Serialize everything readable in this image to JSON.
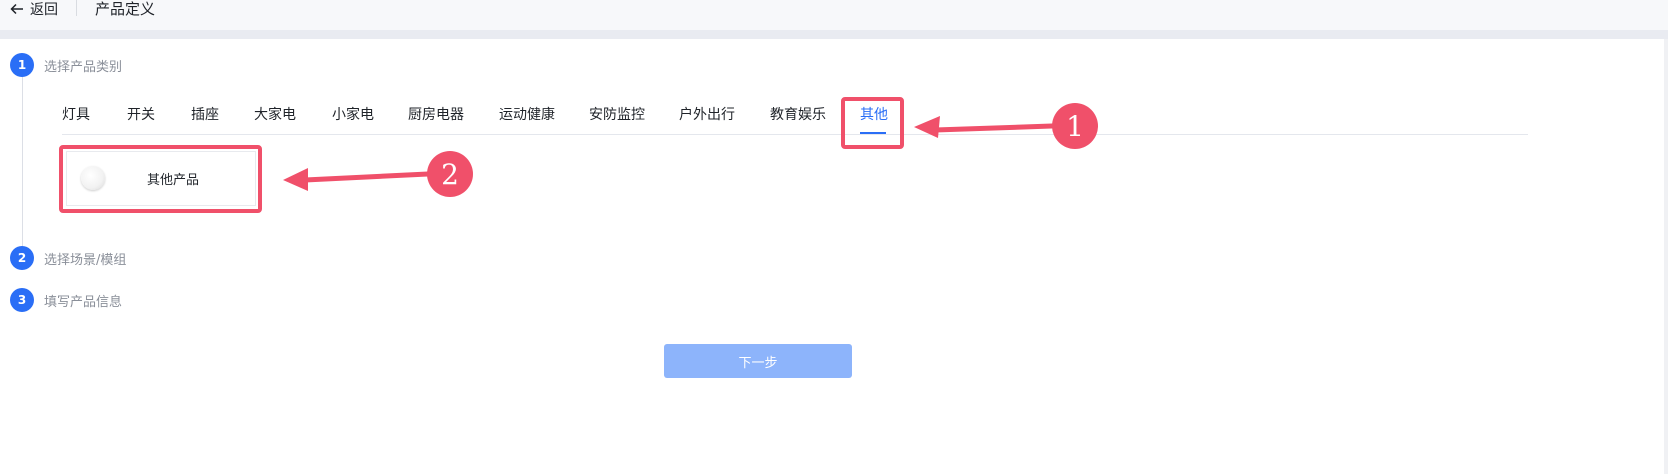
{
  "header": {
    "back_label": "返回",
    "title": "产品定义"
  },
  "steps": [
    {
      "number": "1",
      "label": "选择产品类别"
    },
    {
      "number": "2",
      "label": "选择场景/模组"
    },
    {
      "number": "3",
      "label": "填写产品信息"
    }
  ],
  "tabs": [
    {
      "label": "灯具"
    },
    {
      "label": "开关"
    },
    {
      "label": "插座"
    },
    {
      "label": "大家电"
    },
    {
      "label": "小家电"
    },
    {
      "label": "厨房电器"
    },
    {
      "label": "运动健康"
    },
    {
      "label": "安防监控"
    },
    {
      "label": "户外出行"
    },
    {
      "label": "教育娱乐"
    },
    {
      "label": "其他",
      "active": true
    }
  ],
  "products": [
    {
      "name": "其他产品"
    }
  ],
  "callouts": [
    "1",
    "2"
  ],
  "next_button_label": "下一步",
  "colors": {
    "accent": "#2a6ef6",
    "annotation": "#f0506a",
    "button_disabled": "#8db4fb"
  }
}
